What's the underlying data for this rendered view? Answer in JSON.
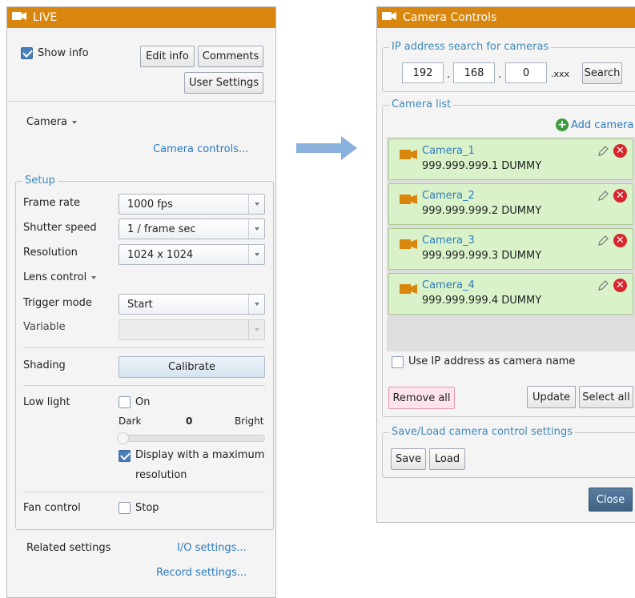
{
  "live_panel": {
    "title": "LIVE",
    "show_info_label": "Show info",
    "show_info_checked": true,
    "edit_info_label": "Edit info",
    "comments_label": "Comments",
    "user_settings_label": "User Settings",
    "camera_label": "Camera",
    "camera_controls_link": "Camera controls...",
    "setup": {
      "legend": "Setup",
      "frame_rate_label": "Frame rate",
      "frame_rate_value": "1000 fps",
      "shutter_label": "Shutter speed",
      "shutter_value": "1 / frame sec",
      "resolution_label": "Resolution",
      "resolution_value": "1024 x 1024",
      "lens_label": "Lens control",
      "trigger_label": "Trigger mode",
      "trigger_value": "Start",
      "variable_label": "Variable",
      "shading_label": "Shading",
      "calibrate_label": "Calibrate",
      "low_light_label": "Low light",
      "on_label": "On",
      "on_checked": false,
      "dark_label": "Dark",
      "slider_value": "0",
      "bright_label": "Bright",
      "max_res_label_1": "Display with a maximum",
      "max_res_label_2": "resolution",
      "max_res_checked": true,
      "fan_label": "Fan control",
      "stop_label": "Stop",
      "stop_checked": false
    },
    "related_label": "Related settings",
    "io_link": "I/O settings...",
    "record_link": "Record settings..."
  },
  "camera_controls": {
    "title": "Camera Controls",
    "ip_search_legend": "IP address search for cameras",
    "ip": [
      "192",
      "168",
      "0"
    ],
    "ip_dot": ".",
    "ip_suffix": ".xxx",
    "search_label": "Search",
    "camera_list_legend": "Camera list",
    "add_camera_label": "Add camera",
    "cameras": [
      {
        "name": "Camera_1",
        "ip": "999.999.999.1  DUMMY"
      },
      {
        "name": "Camera_2",
        "ip": "999.999.999.2  DUMMY"
      },
      {
        "name": "Camera_3",
        "ip": "999.999.999.3  DUMMY"
      },
      {
        "name": "Camera_4",
        "ip": "999.999.999.4  DUMMY"
      }
    ],
    "use_ip_label": "Use IP address as camera name",
    "use_ip_checked": false,
    "remove_all_label": "Remove all",
    "update_label": "Update",
    "select_all_label": "Select all",
    "save_load_legend": "Save/Load camera control settings",
    "save_label": "Save",
    "load_label": "Load",
    "close_label": "Close"
  },
  "colors": {
    "titlebar": "#d9860e",
    "accent_blue": "#2d7bc2",
    "camera_row": "#d9f2c9",
    "arrow": "#8ab0dc",
    "close_button": "#4a6f91"
  },
  "icons": [
    "camera-icon",
    "pencil-icon",
    "delete-icon",
    "add-icon",
    "arrow-right-icon"
  ]
}
